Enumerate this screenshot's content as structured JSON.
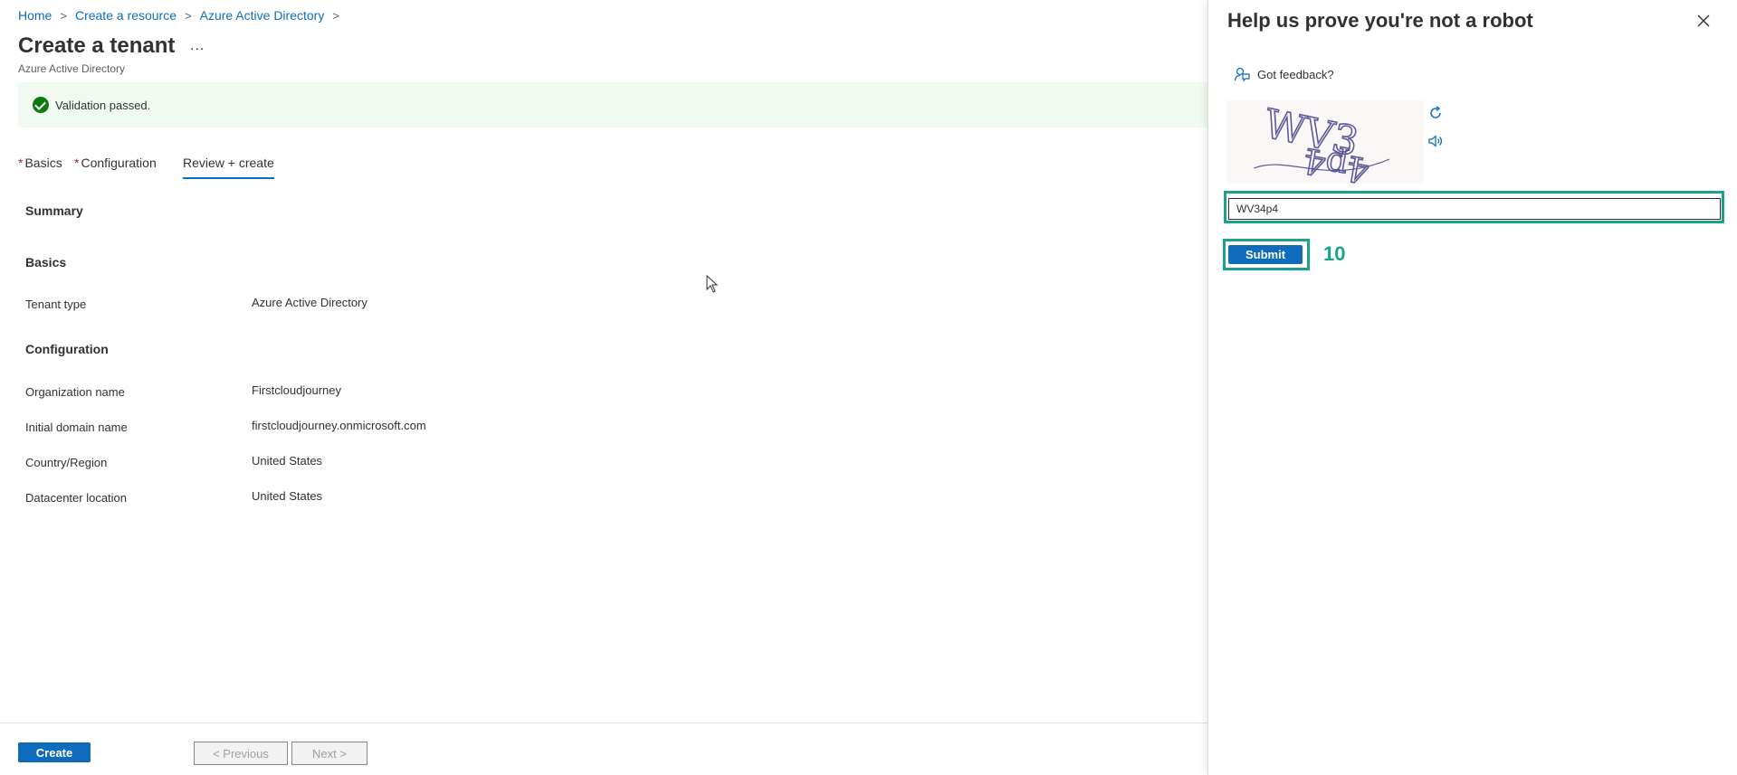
{
  "breadcrumb": {
    "items": [
      "Home",
      "Create a resource",
      "Azure Active Directory"
    ],
    "separator": ">"
  },
  "page": {
    "title": "Create a tenant",
    "more": "...",
    "subtitle": "Azure Active Directory"
  },
  "banner": {
    "text": "Validation passed.",
    "icon": "check-circle-icon",
    "color": "#0e7a0d"
  },
  "tabs": [
    {
      "label": "Basics",
      "required": "*"
    },
    {
      "label": "Configuration",
      "required": "*"
    },
    {
      "label": "Review + create",
      "active": true
    }
  ],
  "summary": {
    "heading": "Summary",
    "basics": {
      "heading": "Basics",
      "rows": [
        {
          "label": "Tenant type",
          "value": "Azure Active Directory"
        }
      ]
    },
    "configuration": {
      "heading": "Configuration",
      "rows": [
        {
          "label": "Organization name",
          "value": "Firstcloudjourney"
        },
        {
          "label": "Initial domain name",
          "value": "firstcloudjourney.onmicrosoft.com"
        },
        {
          "label": "Country/Region",
          "value": "United States"
        },
        {
          "label": "Datacenter location",
          "value": "United States"
        }
      ]
    }
  },
  "footer": {
    "create": "Create",
    "previous": "< Previous",
    "next": "Next >"
  },
  "panel": {
    "title": "Help us prove you're not a robot",
    "feedback": "Got feedback?",
    "captcha_text": "WV34p4",
    "input_value": "WV34p4",
    "submit": "Submit",
    "step_number": "10",
    "highlight_color": "#1aa38a",
    "accent_color": "#0f6cbd"
  }
}
